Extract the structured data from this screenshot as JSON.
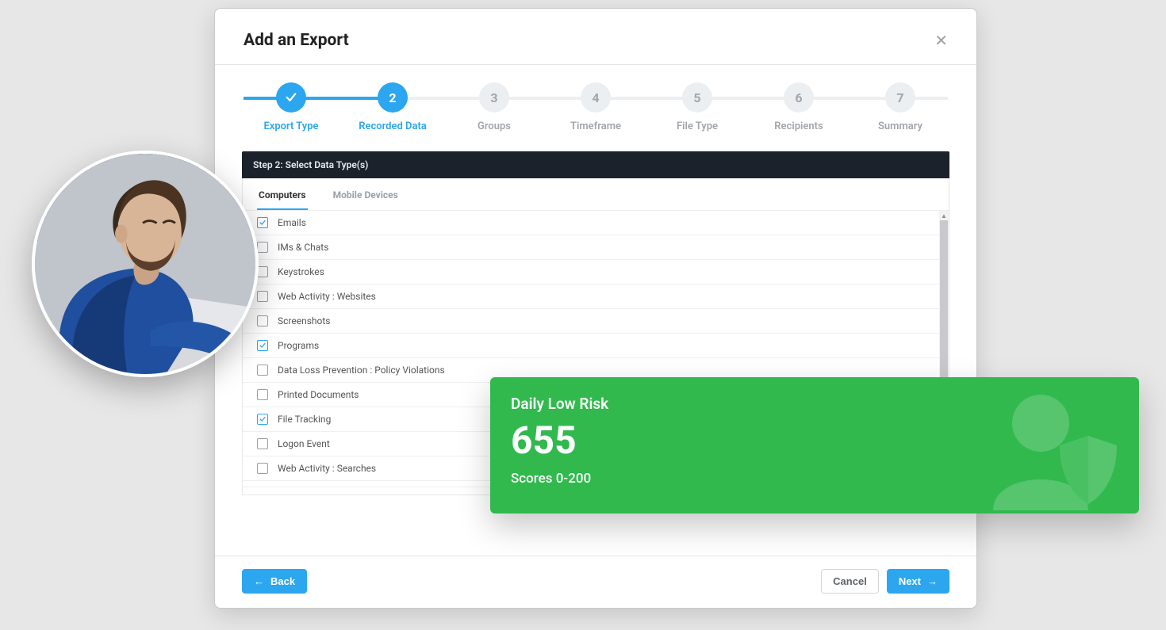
{
  "modal": {
    "title": "Add an Export",
    "section_bar": "Step 2: Select Data Type(s)",
    "steps": [
      {
        "label": "Export Type",
        "state": "done",
        "content": "✓"
      },
      {
        "label": "Recorded Data",
        "state": "active",
        "content": "2"
      },
      {
        "label": "Groups",
        "state": "future",
        "content": "3"
      },
      {
        "label": "Timeframe",
        "state": "future",
        "content": "4"
      },
      {
        "label": "File Type",
        "state": "future",
        "content": "5"
      },
      {
        "label": "Recipients",
        "state": "future",
        "content": "6"
      },
      {
        "label": "Summary",
        "state": "future",
        "content": "7"
      }
    ],
    "tabs": {
      "computers": "Computers",
      "mobile": "Mobile Devices",
      "active": "computers"
    },
    "list": [
      {
        "label": "Emails",
        "checked": true
      },
      {
        "label": "IMs & Chats",
        "checked": false
      },
      {
        "label": "Keystrokes",
        "checked": false
      },
      {
        "label": "Web Activity : Websites",
        "checked": false
      },
      {
        "label": "Screenshots",
        "checked": false
      },
      {
        "label": "Programs",
        "checked": true
      },
      {
        "label": "Data Loss Prevention : Policy Violations",
        "checked": false
      },
      {
        "label": "Printed Documents",
        "checked": false
      },
      {
        "label": "File Tracking",
        "checked": true
      },
      {
        "label": "Logon Event",
        "checked": false
      },
      {
        "label": "Web Activity : Searches",
        "checked": false
      }
    ],
    "footer": {
      "back": "Back",
      "cancel": "Cancel",
      "next": "Next"
    }
  },
  "risk_card": {
    "title": "Daily Low Risk",
    "value": "655",
    "subtitle": "Scores 0-200",
    "color": "#31b94e"
  }
}
